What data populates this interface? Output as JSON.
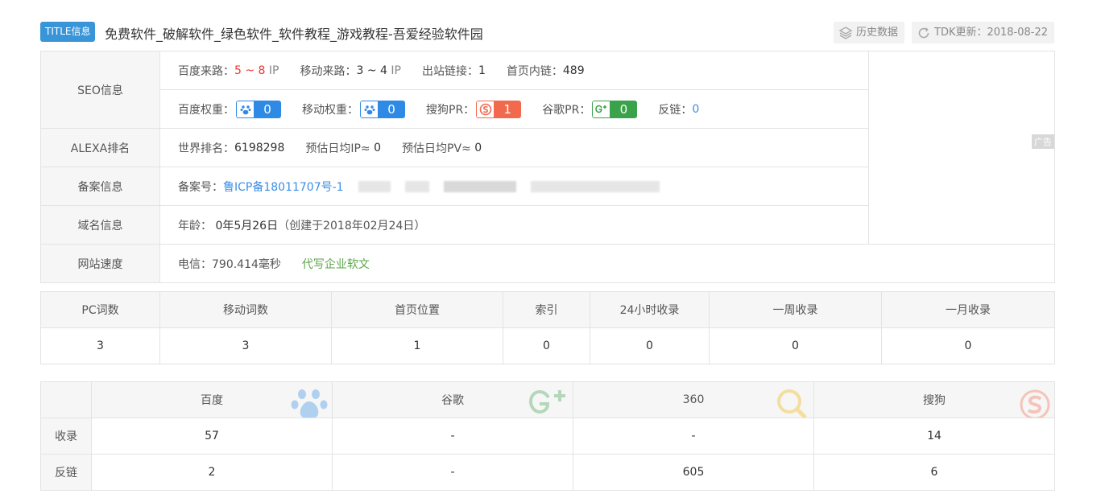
{
  "header": {
    "badge": "TITLE信息",
    "title": "免费软件_破解软件_绿色软件_软件教程_游戏教程-吾爱经验软件园",
    "history_label": "历史数据",
    "tdk_label": "TDK更新：2018-08-22"
  },
  "seo": {
    "label": "SEO信息",
    "baidu_source_key": "百度来路：",
    "baidu_source_value": "5 ~ 8",
    "baidu_source_unit": "IP",
    "mobile_source_key": "移动来路：",
    "mobile_source_value": "3 ~ 4",
    "mobile_source_unit": "IP",
    "outbound_key": "出站链接：",
    "outbound_value": "1",
    "internal_key": "首页内链：",
    "internal_value": "489",
    "baidu_weight_key": "百度权重：",
    "baidu_weight_value": "0",
    "mobile_weight_key": "移动权重：",
    "mobile_weight_value": "0",
    "sogou_pr_key": "搜狗PR：",
    "sogou_pr_value": "1",
    "google_pr_key": "谷歌PR：",
    "google_pr_value": "0",
    "backlink_key": "反链：",
    "backlink_value": "0"
  },
  "alexa": {
    "label": "ALEXA排名",
    "world_key": "世界排名：",
    "world_value": "6198298",
    "ip_key": "预估日均IP≈",
    "ip_value": "0",
    "pv_key": "预估日均PV≈",
    "pv_value": "0"
  },
  "icp": {
    "label": "备案信息",
    "key": "备案号：",
    "value": "鲁ICP备18011707号-1"
  },
  "domain": {
    "label": "域名信息",
    "age_key": "年龄：",
    "age_value": "0年5月26日",
    "created": "（创建于2018年02月24日）"
  },
  "speed": {
    "label": "网站速度",
    "value": "电信：790.414毫秒",
    "ad_link": "代写企业软文"
  },
  "ad_tag": "广告",
  "stats": {
    "headers": [
      "PC词数",
      "移动词数",
      "首页位置",
      "索引",
      "24小时收录",
      "一周收录",
      "一月收录"
    ],
    "values": [
      "3",
      "3",
      "1",
      "0",
      "0",
      "0",
      "0"
    ]
  },
  "engines": {
    "headers": [
      "百度",
      "谷歌",
      "360",
      "搜狗"
    ],
    "row_labels": [
      "收录",
      "反链"
    ],
    "indexed": [
      "57",
      "-",
      "-",
      "14"
    ],
    "backlinks": [
      "2",
      "-",
      "605",
      "6"
    ]
  },
  "colors": {
    "accent": "#3a95d8",
    "baidu": "#2f8ae5",
    "sogou": "#f26a4e",
    "google": "#3aa24a",
    "highlight_red": "#e33333",
    "link_green": "#5aa64a"
  }
}
